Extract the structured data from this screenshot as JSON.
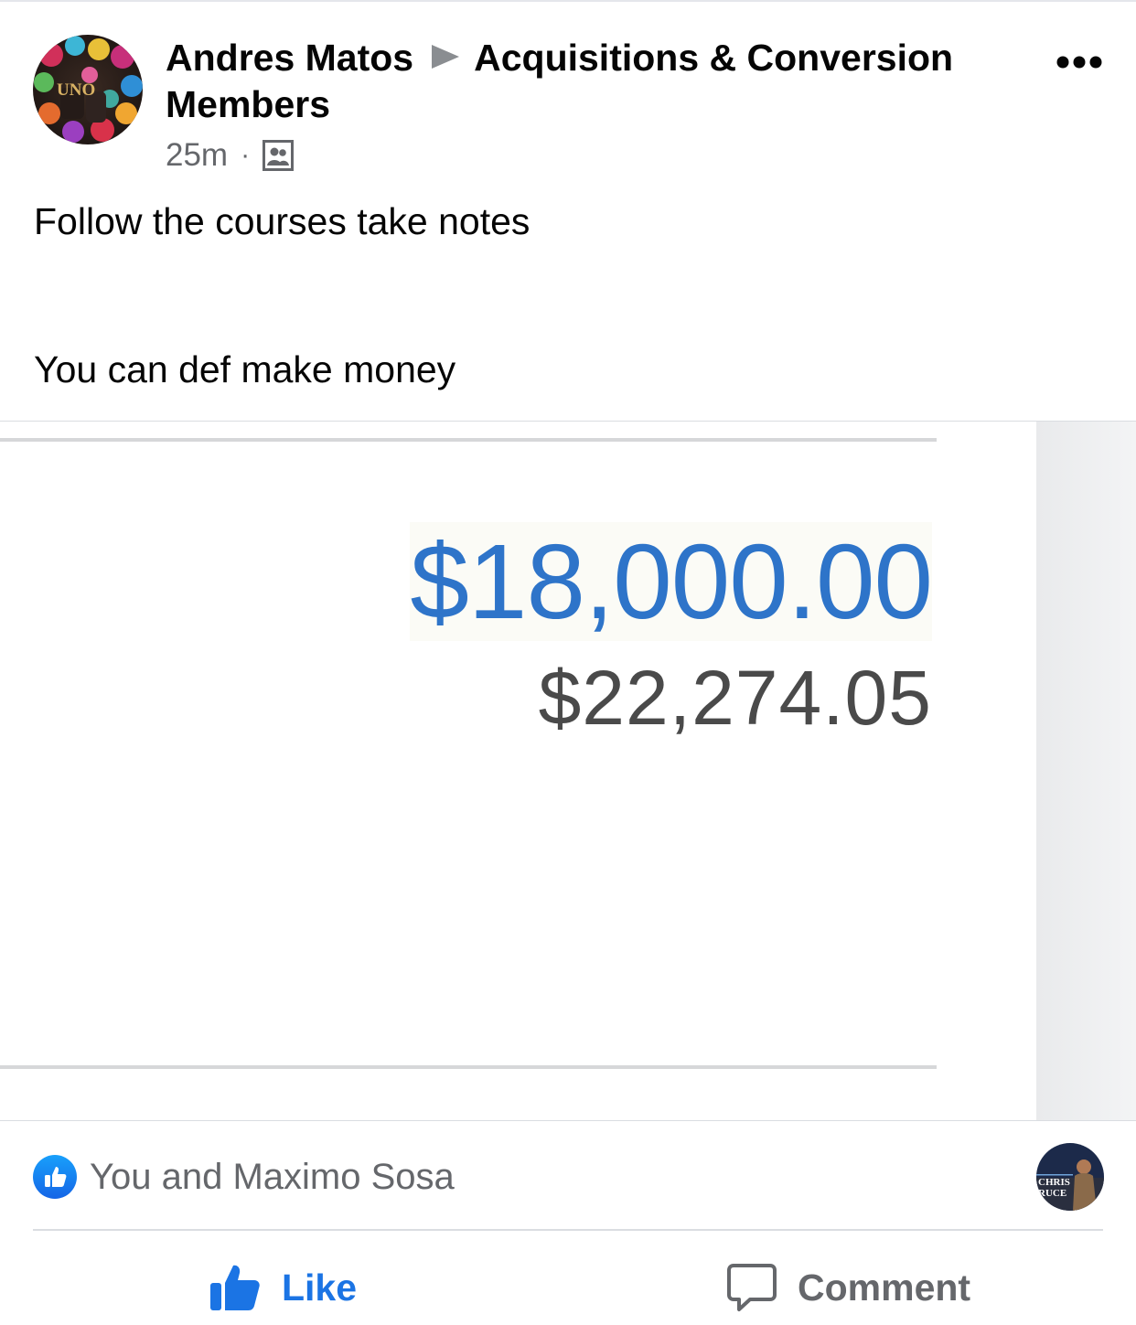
{
  "post": {
    "author": "Andres Matos",
    "group": "Acquisitions & Conversion Members",
    "time": "25m",
    "separator": "·",
    "audience_icon": "group-members-icon",
    "more_icon": "more-dots-icon",
    "text_lines": [
      "Follow the courses take notes",
      "You can def make money"
    ]
  },
  "image": {
    "primary_amount": "$18,000.00",
    "secondary_amount": "$22,274.05",
    "primary_color": "#2e74c9"
  },
  "reactions": {
    "summary": "You and Maximo Sosa",
    "icon": "like-reaction-icon",
    "seen_avatar_label_1": "CHRIS",
    "seen_avatar_label_2": "RUCE"
  },
  "actions": {
    "like_label": "Like",
    "comment_label": "Comment",
    "like_color": "#1b74e4"
  },
  "avatar_label": "UNO"
}
